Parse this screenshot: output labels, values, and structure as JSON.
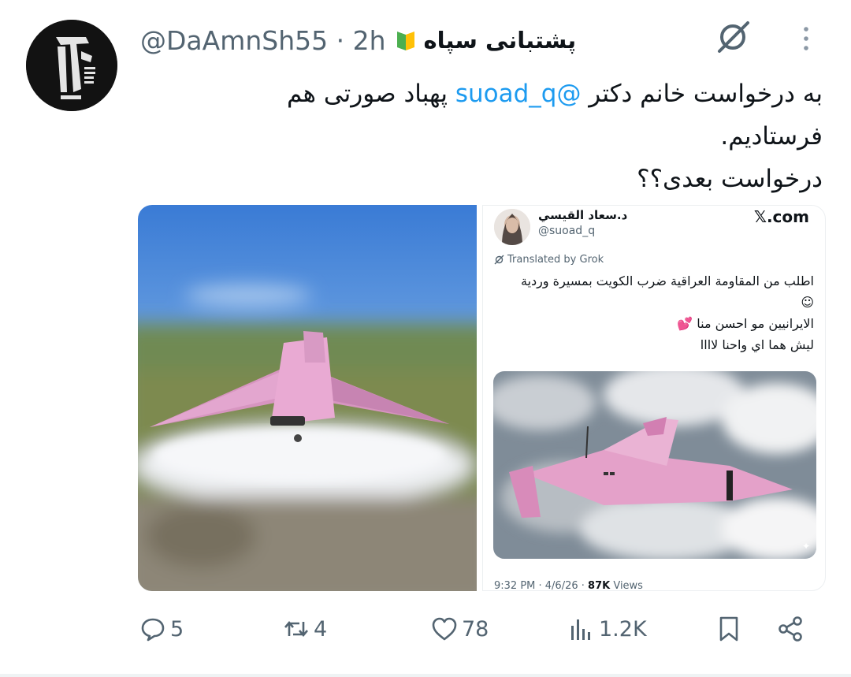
{
  "tweet": {
    "display_name": "پشتبانی سپاه",
    "badge_icon": "green-yellow-shield-badge-icon",
    "handle": "@DaAmnSh55",
    "separator": "·",
    "time": "2h",
    "text_line1_before": "به درخواست خانم دکتر ",
    "text_mention": "@suoad_q",
    "text_line1_after": " پهباد صورتی هم",
    "text_line2": "فرستادیم.",
    "text_line3": "درخواست بعدی؟؟",
    "mention_color": "#1d9bf0"
  },
  "embedded_post": {
    "author_name": "د.سعاد القيسي",
    "author_handle": "@suoad_q",
    "site_label": "𝕏.com",
    "translated_label": "Translated by Grok",
    "line1": "اطلب من المقاومة العراقية ضرب الكويت بمسيرة وردية",
    "line2": "☺",
    "line3": "الايرانيين مو احسن منا 💕",
    "line4": "ليش هما اي واحنا لاااا",
    "timestamp": "9:32 PM · 4/6/26 · ",
    "views_count": "87K",
    "views_label": " Views"
  },
  "actions": {
    "replies": "5",
    "reposts": "4",
    "likes": "78",
    "views": "1.2K"
  },
  "icons": {
    "grok": "grok-icon",
    "more": "more-vertical-icon",
    "reply": "reply-icon",
    "repost": "repost-icon",
    "like": "heart-icon",
    "views": "views-bar-icon",
    "bookmark": "bookmark-icon",
    "share": "share-icon"
  },
  "colors": {
    "text_primary": "#0f1419",
    "text_secondary": "#536471",
    "link": "#1d9bf0",
    "drone_pink": "#e6a0c8"
  }
}
